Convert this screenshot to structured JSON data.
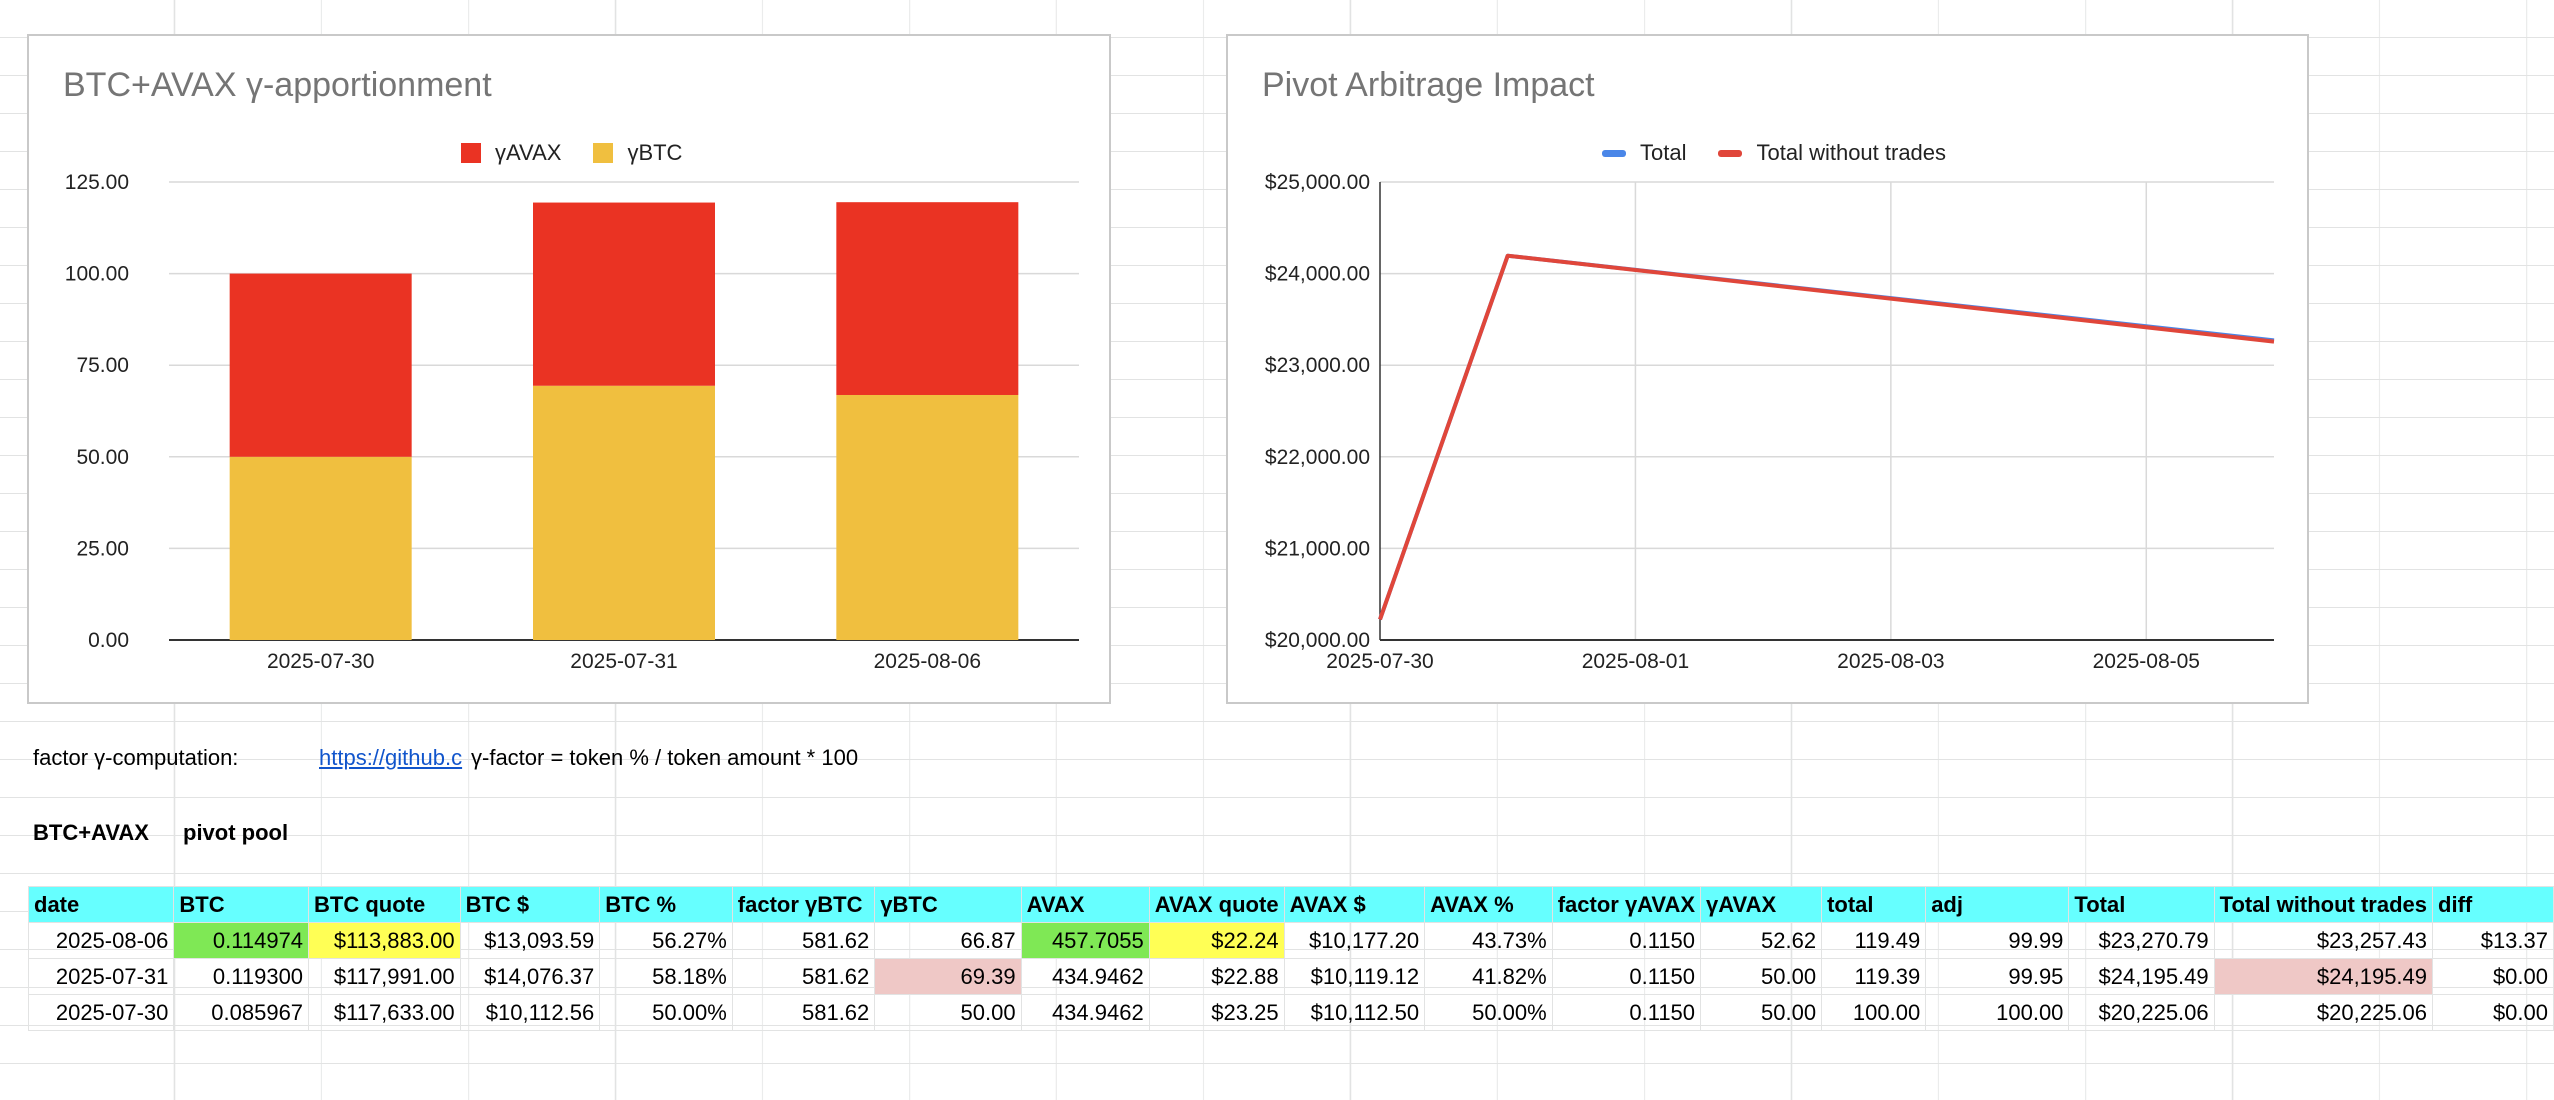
{
  "colors": {
    "gamma_avax": "#ea3323",
    "gamma_btc": "#f0bf3f",
    "total_line": "#4a86e8",
    "total_without_trades_line": "#e0463a",
    "header_fill": "#66ffff",
    "highlight_green": "#7fe855",
    "highlight_yellow": "#ffff55",
    "highlight_pink": "#efc8c6"
  },
  "chart_data": [
    {
      "type": "bar",
      "stacked": true,
      "title": "BTC+AVAX γ-apportionment",
      "categories": [
        "2025-07-30",
        "2025-07-31",
        "2025-08-06"
      ],
      "series": [
        {
          "name": "γAVAX",
          "values": [
            50.0,
            50.0,
            52.62
          ],
          "color": "#ea3323"
        },
        {
          "name": "γBTC",
          "values": [
            50.0,
            69.39,
            66.87
          ],
          "color": "#f0bf3f"
        }
      ],
      "legend_order": [
        "γAVAX",
        "γBTC"
      ],
      "ylim": [
        0,
        125
      ],
      "yticks": [
        "0.00",
        "25.00",
        "50.00",
        "75.00",
        "100.00",
        "125.00"
      ],
      "legend": "top",
      "grid": true
    },
    {
      "type": "line",
      "title": "Pivot Arbitrage Impact",
      "x": [
        "2025-07-30",
        "2025-07-31",
        "2025-08-06"
      ],
      "series": [
        {
          "name": "Total",
          "values": [
            20225.06,
            24195.49,
            23270.79
          ],
          "color": "#4a86e8"
        },
        {
          "name": "Total without trades",
          "values": [
            20225.06,
            24195.49,
            23257.43
          ],
          "color": "#e0463a"
        }
      ],
      "xticks": [
        "2025-07-30",
        "2025-08-01",
        "2025-08-03",
        "2025-08-05"
      ],
      "xlim": [
        "2025-07-30",
        "2025-08-06"
      ],
      "ylim": [
        20000,
        25000
      ],
      "yticks": [
        "$20,000.00",
        "$21,000.00",
        "$22,000.00",
        "$23,000.00",
        "$24,000.00",
        "$25,000.00"
      ],
      "legend": "top",
      "grid": true
    }
  ],
  "note": {
    "label": "factor γ-computation:",
    "link_text": "https://github.c",
    "formula": "γ-factor = token % / token amount * 100"
  },
  "section": {
    "title": "BTC+AVAX",
    "subtitle": "pivot pool"
  },
  "table": {
    "headers": [
      "date",
      "BTC",
      "BTC quote",
      "BTC $",
      "BTC %",
      "factor γBTC",
      "γBTC",
      "AVAX",
      "AVAX quote",
      "AVAX $",
      "AVAX %",
      "factor γAVAX",
      "γAVAX",
      "total",
      "adj",
      "Total",
      "Total without trades",
      "diff"
    ],
    "rows": [
      [
        "2025-08-06",
        "0.114974",
        "$113,883.00",
        "$13,093.59",
        "56.27%",
        "581.62",
        "66.87",
        "457.7055",
        "$22.24",
        "$10,177.20",
        "43.73%",
        "0.1150",
        "52.62",
        "119.49",
        "99.99",
        "$23,270.79",
        "$23,257.43",
        "$13.37"
      ],
      [
        "2025-07-31",
        "0.119300",
        "$117,991.00",
        "$14,076.37",
        "58.18%",
        "581.62",
        "69.39",
        "434.9462",
        "$22.88",
        "$10,119.12",
        "41.82%",
        "0.1150",
        "50.00",
        "119.39",
        "99.95",
        "$24,195.49",
        "$24,195.49",
        "$0.00"
      ],
      [
        "2025-07-30",
        "0.085967",
        "$117,633.00",
        "$10,112.56",
        "50.00%",
        "581.62",
        "50.00",
        "434.9462",
        "$23.25",
        "$10,112.50",
        "50.00%",
        "0.1150",
        "50.00",
        "100.00",
        "100.00",
        "$20,225.06",
        "$20,225.06",
        "$0.00"
      ]
    ]
  }
}
